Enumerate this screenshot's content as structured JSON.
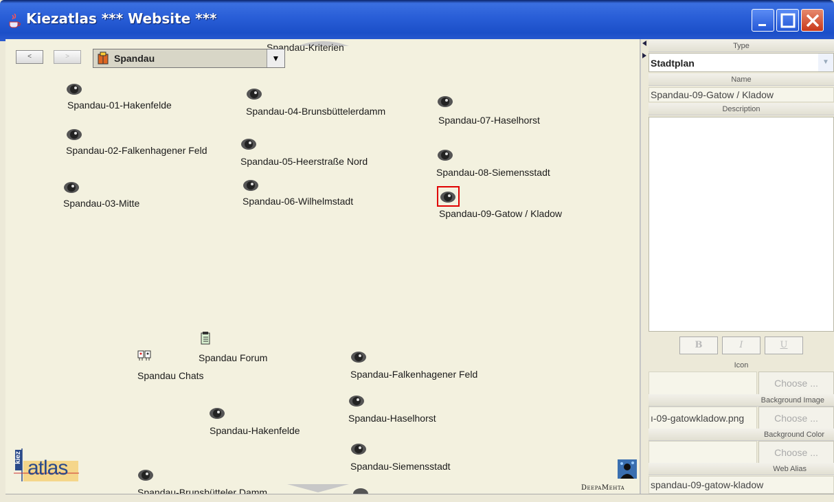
{
  "window": {
    "title": "Kiezatlas *** Website ***"
  },
  "map": {
    "back_label": "<",
    "forward_label": ">",
    "topicmap_name": "Spandau",
    "criteria_label": "Spandau-Kriterien",
    "nodes": [
      {
        "label": "Spandau-01-Hakenfelde"
      },
      {
        "label": "Spandau-02-Falkenhagener Feld"
      },
      {
        "label": "Spandau-03-Mitte"
      },
      {
        "label": "Spandau-04-Brunsbüttelerdamm"
      },
      {
        "label": "Spandau-05-Heerstraße Nord"
      },
      {
        "label": "Spandau-06-Wilhelmstadt"
      },
      {
        "label": "Spandau-07-Haselhorst"
      },
      {
        "label": "Spandau-08-Siemensstadt"
      },
      {
        "label": "Spandau-09-Gatow / Kladow"
      },
      {
        "label": "Spandau Forum"
      },
      {
        "label": "Spandau Chats"
      },
      {
        "label": "Spandau-Falkenhagener Feld"
      },
      {
        "label": "Spandau-Haselhorst"
      },
      {
        "label": "Spandau-Hakenfelde"
      },
      {
        "label": "Spandau-Siemensstadt"
      },
      {
        "label": "Spandau-Brunsbütteler Damm"
      }
    ],
    "kiez_logo_text": "atlas",
    "kiez_logo_side": "kiez",
    "deepamehta_text": "DeepaMehta"
  },
  "panel": {
    "type_header": "Type",
    "type_value": "Stadtplan",
    "name_header": "Name",
    "name_value": "Spandau-09-Gatow / Kladow",
    "description_header": "Description",
    "bold_label": "B",
    "italic_label": "I",
    "underline_label": "U",
    "icon_header": "Icon",
    "icon_value": "",
    "bgimage_header": "Background Image",
    "bgimage_value": "ı-09-gatowkladow.png",
    "bgcolor_header": "Background Color",
    "bgcolor_value": "",
    "choose_label": "Choose ...",
    "webalias_header": "Web Alias",
    "webalias_value": "spandau-09-gatow-kladow"
  },
  "colors": {
    "titlebar": "#2a5fd8",
    "map_bg": "#f3f1df",
    "selection": "#e00000"
  },
  "icons": {
    "eye": "eye-icon",
    "forum": "forum-icon",
    "chat": "chat-icon",
    "topicmap": "topicmap-icon"
  }
}
